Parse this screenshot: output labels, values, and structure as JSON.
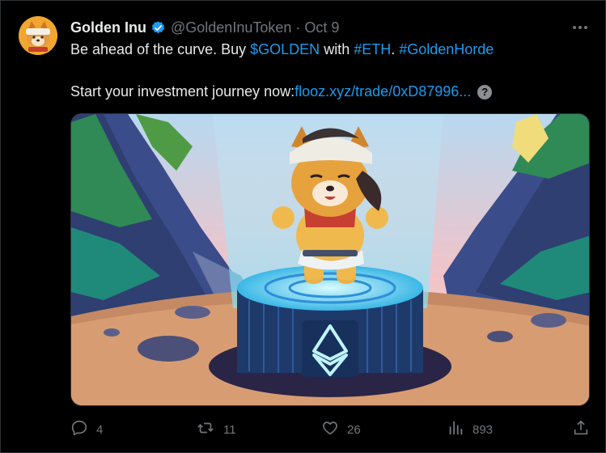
{
  "tweet": {
    "author_name": "Golden Inu",
    "author_handle": "@GoldenInuToken",
    "separator": "·",
    "date": "Oct 9",
    "text_line1_part1": "Be ahead of the curve. Buy ",
    "text_line1_cashtag": "$GOLDEN",
    "text_line1_part2": " with ",
    "text_line1_hashtag1": "#ETH",
    "text_line1_part3": ". ",
    "text_line1_hashtag2": "#GoldenHorde",
    "text_line2_prefix": "Start your investment journey now: ",
    "text_line2_link": "flooz.xyz/trade/0xD87996...",
    "help_badge": "?"
  },
  "actions": {
    "replies": "4",
    "reposts": "11",
    "likes": "26",
    "views": "893"
  },
  "colors": {
    "link": "#1d9bf0",
    "muted": "#71767b",
    "verified": "#1d9bf0",
    "background": "#000000"
  },
  "icons": [
    "verified-badge-icon",
    "more-icon",
    "reply-icon",
    "repost-icon",
    "like-icon",
    "views-icon",
    "share-icon"
  ]
}
